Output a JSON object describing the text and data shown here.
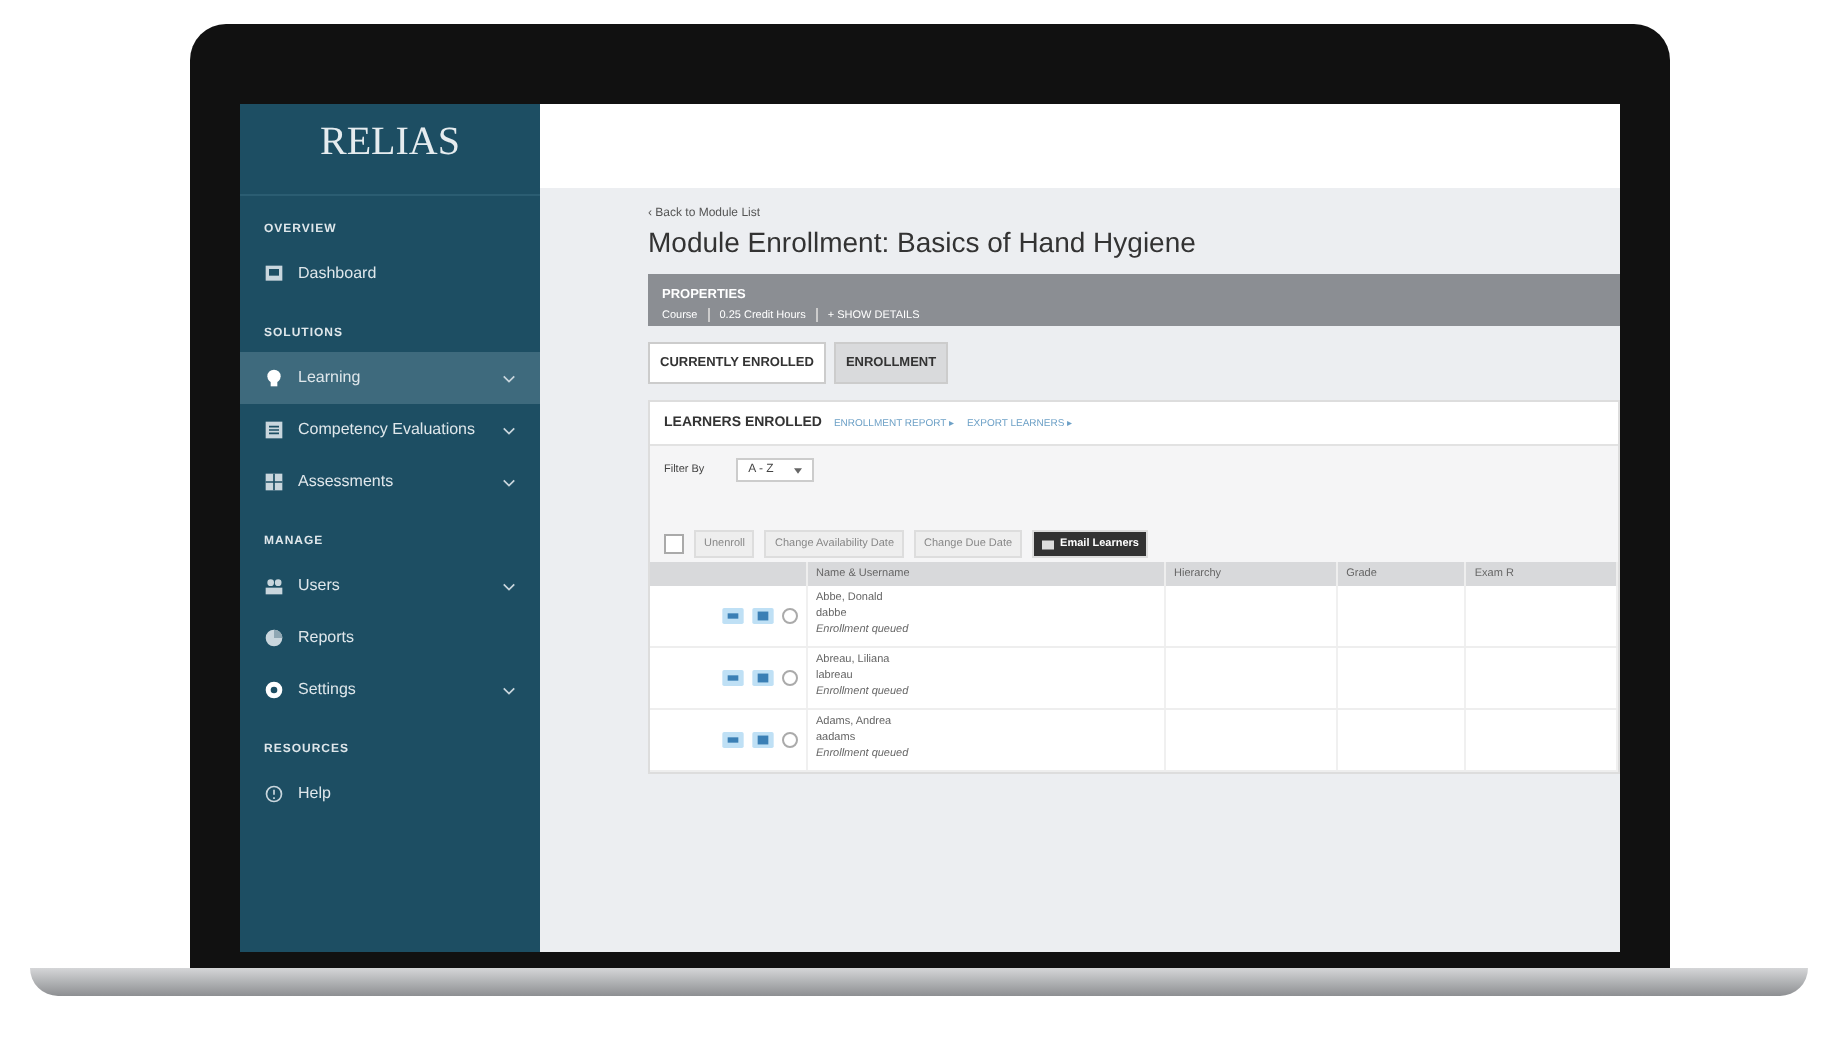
{
  "logo": "RELIAS",
  "sidebar": {
    "sections": [
      {
        "title": "OVERVIEW",
        "items": [
          {
            "label": "Dashboard",
            "kind": "dashboard",
            "expandable": false,
            "selected": false
          }
        ]
      },
      {
        "title": "SOLUTIONS",
        "items": [
          {
            "label": "Learning",
            "kind": "bulb",
            "expandable": true,
            "selected": true
          },
          {
            "label": "Competency Evaluations",
            "kind": "list",
            "expandable": true,
            "selected": false
          },
          {
            "label": "Assessments",
            "kind": "grid",
            "expandable": true,
            "selected": false
          }
        ]
      },
      {
        "title": "MANAGE",
        "items": [
          {
            "label": "Users",
            "kind": "users",
            "expandable": true,
            "selected": false
          },
          {
            "label": "Reports",
            "kind": "pie",
            "expandable": false,
            "selected": false
          },
          {
            "label": "Settings",
            "kind": "gear",
            "expandable": true,
            "selected": false
          }
        ]
      },
      {
        "title": "RESOURCES",
        "items": [
          {
            "label": "Help",
            "kind": "help",
            "expandable": false,
            "selected": false
          }
        ]
      }
    ]
  },
  "back_link": "‹ Back to Module List",
  "title": "Module Enrollment: Basics of Hand Hygiene",
  "properties": {
    "heading": "PROPERTIES",
    "meta": [
      "Course",
      "0.25 Credit Hours",
      "+ SHOW DETAILS"
    ]
  },
  "tabs": [
    {
      "label": "CURRENTLY ENROLLED",
      "selected": true
    },
    {
      "label": "ENROLLMENT",
      "selected": false
    }
  ],
  "panel": {
    "heading": "LEARNERS ENROLLED",
    "links": [
      "ENROLLMENT REPORT ▸",
      "EXPORT LEARNERS ▸"
    ],
    "filter_label": "Filter By",
    "filter_value": "A - Z",
    "select_all": {
      "checked": false
    },
    "actions": [
      {
        "label": "Unenroll",
        "primary": false
      },
      {
        "label": "Change Availability Date",
        "primary": false
      },
      {
        "label": "Change Due Date",
        "primary": false
      },
      {
        "label": "Email Learners",
        "primary": true
      }
    ]
  },
  "table": {
    "columns": [
      "Name & Username",
      "Hierarchy",
      "Grade",
      "Exam R"
    ],
    "rows": [
      {
        "name": "Abbe, Donald",
        "username": "dabbe",
        "status": "Enrollment queued",
        "checked": false
      },
      {
        "name": "Abreau, Liliana",
        "username": "labreau",
        "status": "Enrollment queued",
        "checked": false
      },
      {
        "name": "Adams, Andrea",
        "username": "aadams",
        "status": "Enrollment queued",
        "checked": false
      }
    ]
  }
}
